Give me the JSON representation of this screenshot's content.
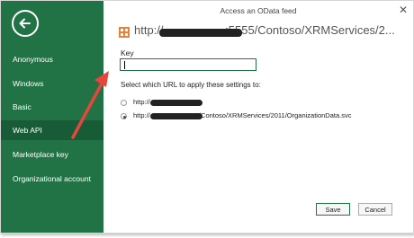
{
  "dialog": {
    "title": "Access an OData feed",
    "close_glyph": "✕",
    "feed_url": "http://                   :5555/Contoso/XRMServices/2..."
  },
  "sidebar": {
    "back_icon": "back-arrow-icon",
    "items": [
      {
        "label": "Anonymous",
        "active": false
      },
      {
        "label": "Windows",
        "active": false
      },
      {
        "label": "Basic",
        "active": false
      },
      {
        "label": "Web API",
        "active": true
      },
      {
        "label": "Marketplace key",
        "active": false
      },
      {
        "label": "Organizational account",
        "active": false
      }
    ]
  },
  "form": {
    "key_label": "Key",
    "key_value": "",
    "select_label": "Select which URL to apply these settings to:",
    "options": [
      {
        "text": "http://                  :5555",
        "selected": false
      },
      {
        "text": "http://                 :5555/Contoso/XRMServices/2011/OrganizationData.svc",
        "selected": true
      }
    ]
  },
  "buttons": {
    "save": "Save",
    "cancel": "Cancel"
  },
  "colors": {
    "accent": "#217346",
    "accent_active": "#185c37",
    "annotation_arrow": "#e8463c"
  }
}
